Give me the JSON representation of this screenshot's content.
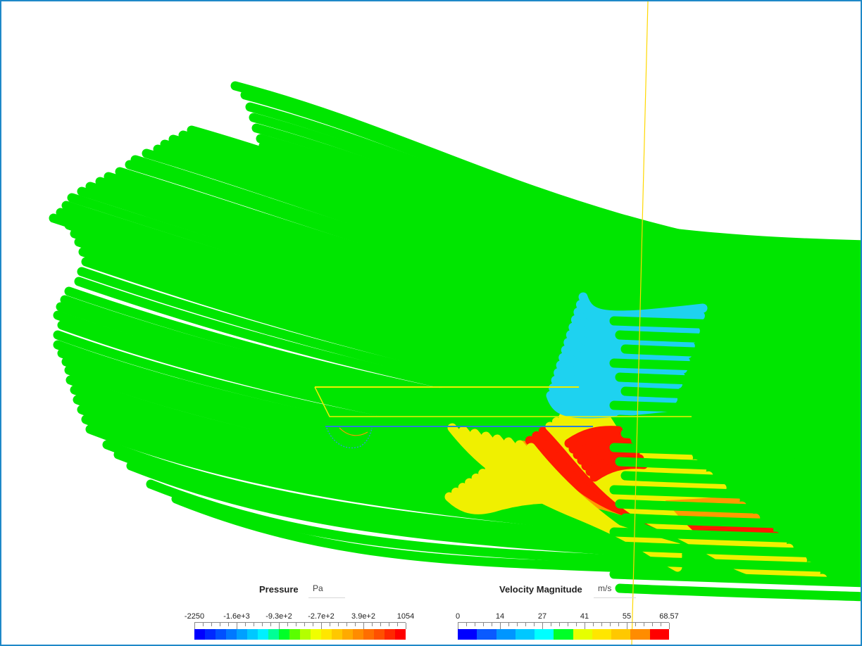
{
  "pressure_legend": {
    "title": "Pressure",
    "unit": "Pa",
    "tick_labels": [
      "-2250",
      "-1.6e+3",
      "-9.3e+2",
      "-2.7e+2",
      "3.9e+2",
      "1054"
    ],
    "colors": [
      "#0000ff",
      "#0028ff",
      "#0050ff",
      "#0078ff",
      "#00a0ff",
      "#00c8ff",
      "#00f0ff",
      "#00ff96",
      "#00ff28",
      "#5aff00",
      "#b4ff00",
      "#f0ff00",
      "#ffe600",
      "#ffc800",
      "#ffaa00",
      "#ff8c00",
      "#ff6e00",
      "#ff5000",
      "#ff2800",
      "#ff0000"
    ]
  },
  "velocity_legend": {
    "title": "Velocity Magnitude",
    "unit": "m/s",
    "tick_labels": [
      "0",
      "14",
      "27",
      "41",
      "55",
      "68.57"
    ],
    "colors": [
      "#0000ff",
      "#0a5aff",
      "#0096ff",
      "#00c8ff",
      "#00ffff",
      "#00ff28",
      "#e6ff00",
      "#ffe600",
      "#ffc800",
      "#ff8c00",
      "#ff0000"
    ]
  },
  "colors": {
    "border": "#1e88c8",
    "streamline_green": "#00e600",
    "streamline_cyan": "#1ed2f0",
    "streamline_yellow": "#f0f000",
    "streamline_orange": "#ff9a00",
    "streamline_red": "#ff1a00",
    "probe_line": "#ffd800"
  }
}
